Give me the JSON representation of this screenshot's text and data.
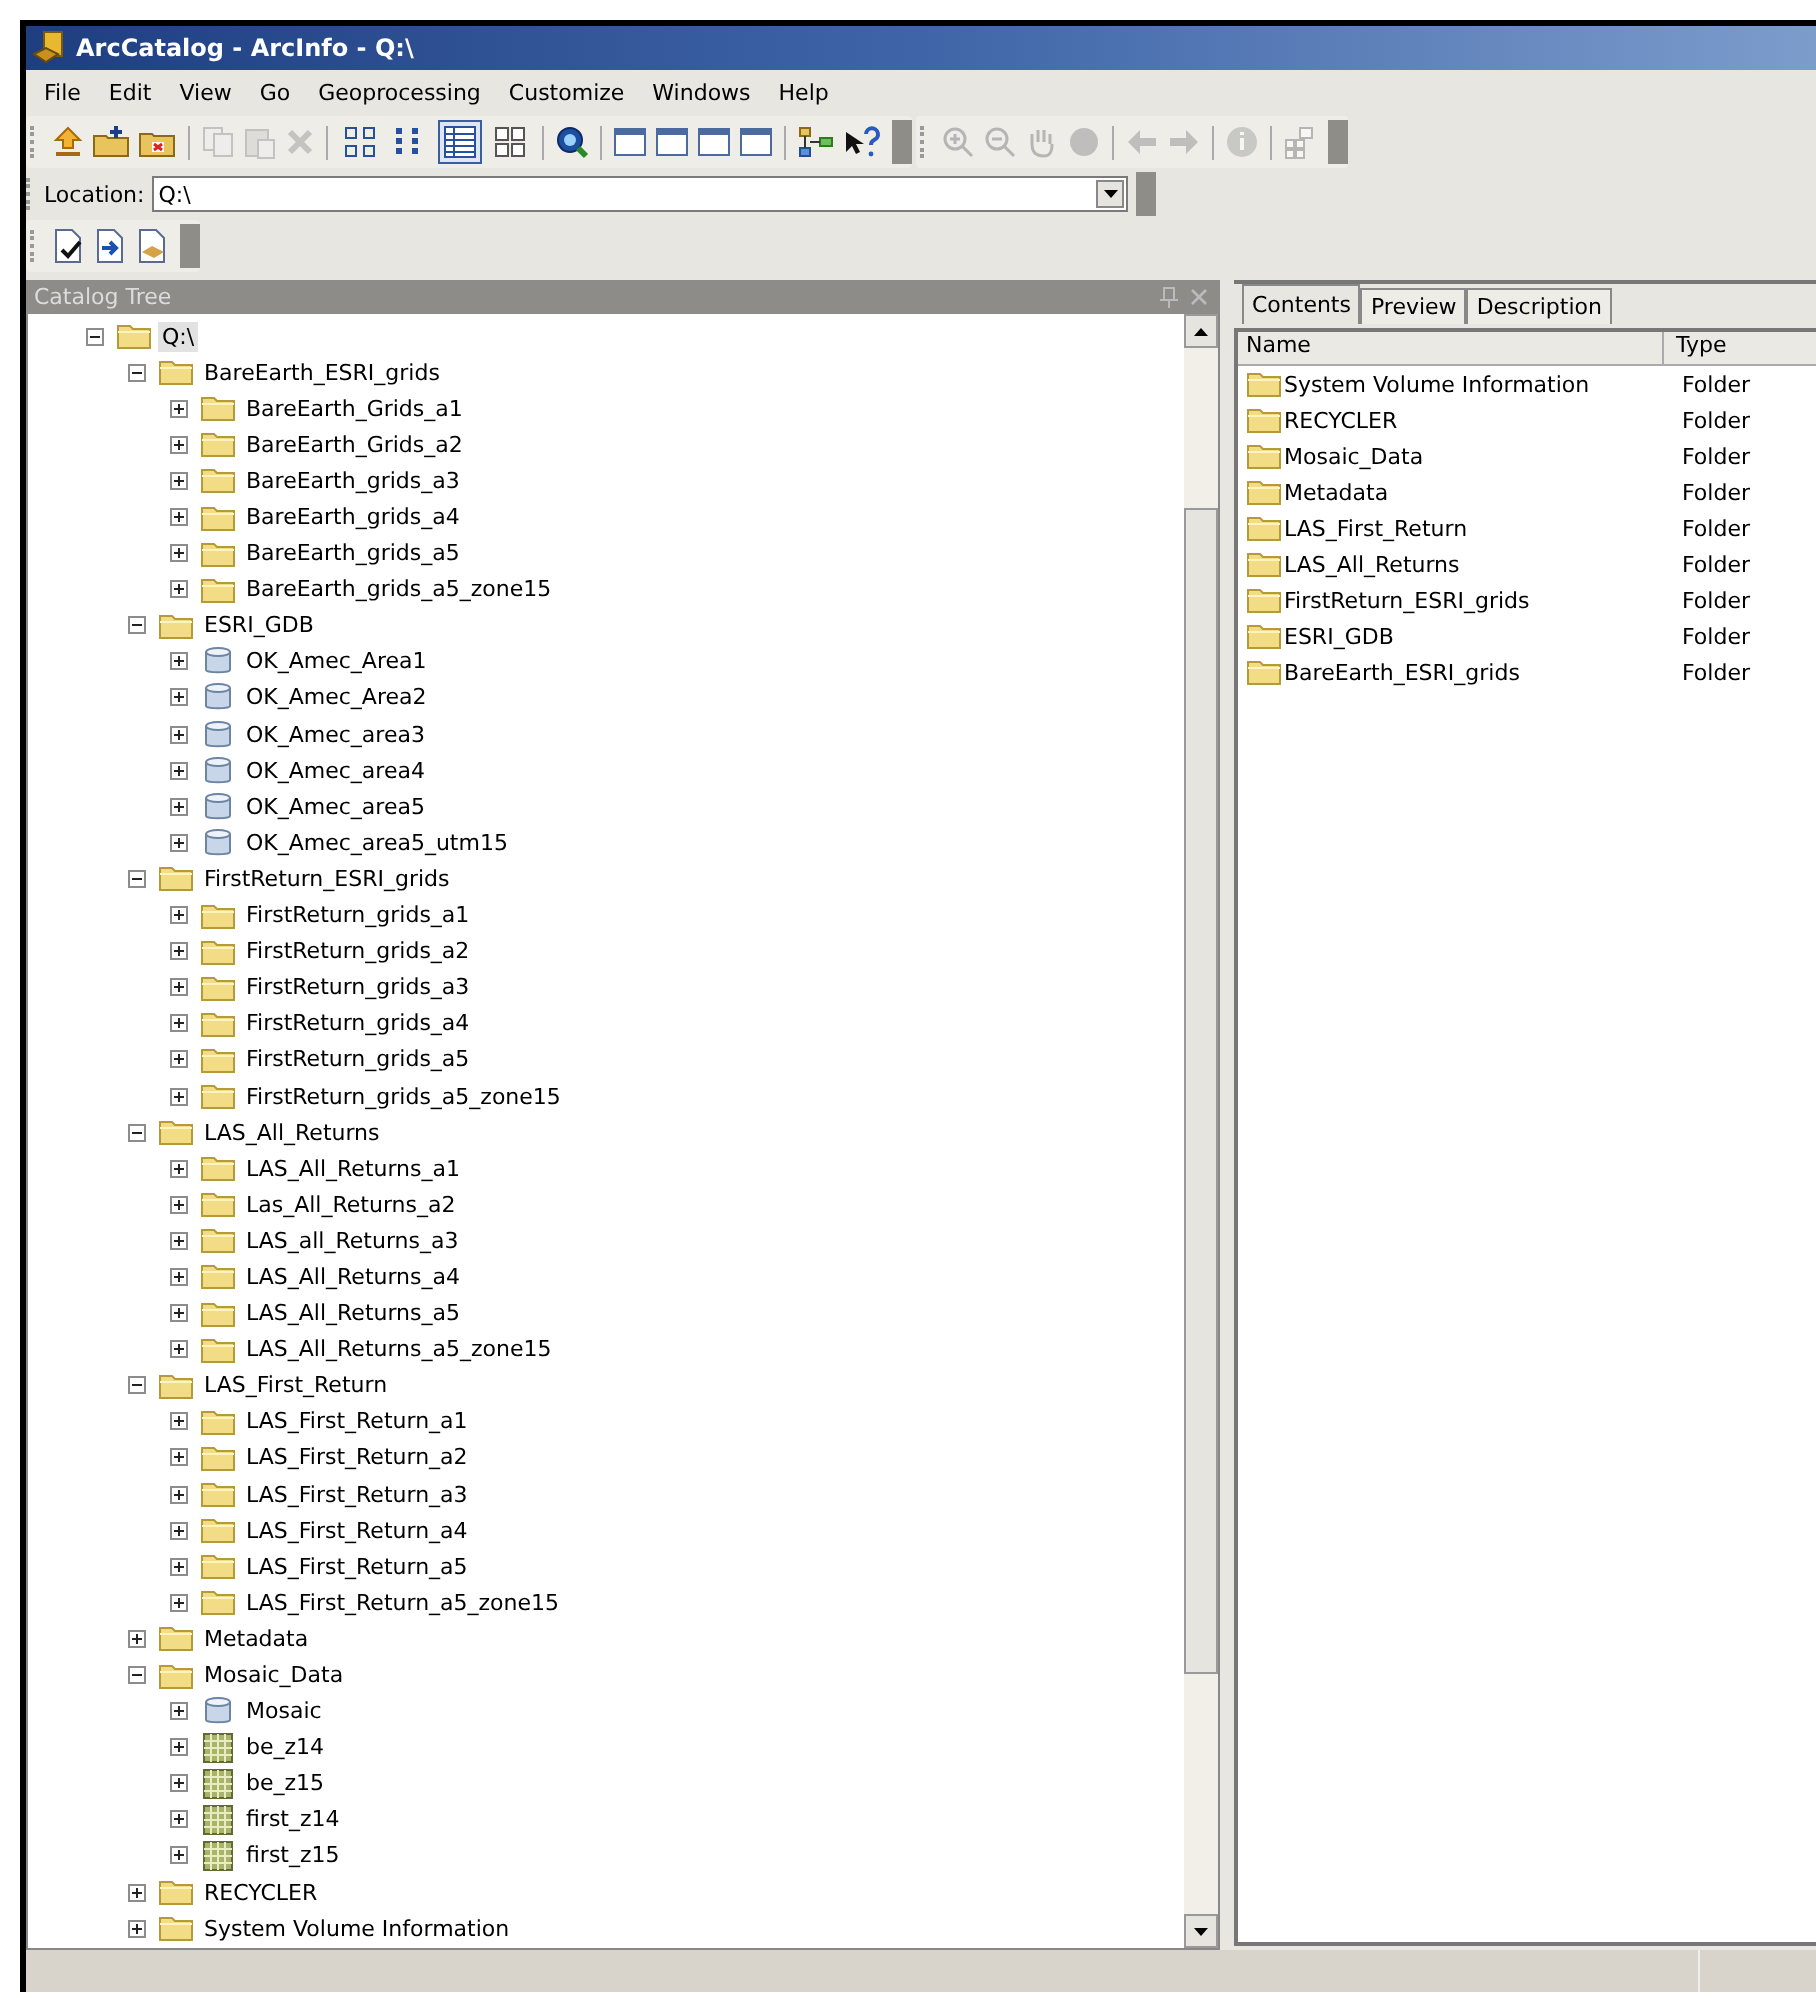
{
  "window": {
    "title": "ArcCatalog - ArcInfo - Q:\\"
  },
  "menu": [
    "File",
    "Edit",
    "View",
    "Go",
    "Geoprocessing",
    "Customize",
    "Windows",
    "Help"
  ],
  "view_buttons": [
    {
      "selected": false
    },
    {
      "selected": false
    },
    {
      "selected": true
    },
    {
      "selected": false
    }
  ],
  "location": {
    "label": "Location:",
    "value": "Q:\\"
  },
  "catalog_tree": {
    "title": "Catalog Tree",
    "tree": [
      {
        "label": "Q:\\",
        "kind": "folder",
        "expanded": true,
        "selected": true,
        "children": [
          {
            "label": "BareEarth_ESRI_grids",
            "kind": "folder",
            "expanded": true,
            "selected": false,
            "children": [
              {
                "label": "BareEarth_Grids_a1",
                "kind": "folder",
                "expanded": false,
                "selected": false
              },
              {
                "label": "BareEarth_Grids_a2",
                "kind": "folder",
                "expanded": false,
                "selected": false
              },
              {
                "label": "BareEarth_grids_a3",
                "kind": "folder",
                "expanded": false,
                "selected": false
              },
              {
                "label": "BareEarth_grids_a4",
                "kind": "folder",
                "expanded": false,
                "selected": false
              },
              {
                "label": "BareEarth_grids_a5",
                "kind": "folder",
                "expanded": false,
                "selected": false
              },
              {
                "label": "BareEarth_grids_a5_zone15",
                "kind": "folder",
                "expanded": false,
                "selected": false
              }
            ]
          },
          {
            "label": "ESRI_GDB",
            "kind": "folder",
            "expanded": true,
            "selected": false,
            "children": [
              {
                "label": "OK_Amec_Area1",
                "kind": "database",
                "expanded": false,
                "selected": false
              },
              {
                "label": "OK_Amec_Area2",
                "kind": "database",
                "expanded": false,
                "selected": false
              },
              {
                "label": "OK_Amec_area3",
                "kind": "database",
                "expanded": false,
                "selected": false
              },
              {
                "label": "OK_Amec_area4",
                "kind": "database",
                "expanded": false,
                "selected": false
              },
              {
                "label": "OK_Amec_area5",
                "kind": "database",
                "expanded": false,
                "selected": false
              },
              {
                "label": "OK_Amec_area5_utm15",
                "kind": "database",
                "expanded": false,
                "selected": false
              }
            ]
          },
          {
            "label": "FirstReturn_ESRI_grids",
            "kind": "folder",
            "expanded": true,
            "selected": false,
            "children": [
              {
                "label": "FirstReturn_grids_a1",
                "kind": "folder",
                "expanded": false,
                "selected": false
              },
              {
                "label": "FirstReturn_grids_a2",
                "kind": "folder",
                "expanded": false,
                "selected": false
              },
              {
                "label": "FirstReturn_grids_a3",
                "kind": "folder",
                "expanded": false,
                "selected": false
              },
              {
                "label": "FirstReturn_grids_a4",
                "kind": "folder",
                "expanded": false,
                "selected": false
              },
              {
                "label": "FirstReturn_grids_a5",
                "kind": "folder",
                "expanded": false,
                "selected": false
              },
              {
                "label": "FirstReturn_grids_a5_zone15",
                "kind": "folder",
                "expanded": false,
                "selected": false
              }
            ]
          },
          {
            "label": "LAS_All_Returns",
            "kind": "folder",
            "expanded": true,
            "selected": false,
            "children": [
              {
                "label": "LAS_All_Returns_a1",
                "kind": "folder",
                "expanded": false,
                "selected": false
              },
              {
                "label": "Las_All_Returns_a2",
                "kind": "folder",
                "expanded": false,
                "selected": false
              },
              {
                "label": "LAS_all_Returns_a3",
                "kind": "folder",
                "expanded": false,
                "selected": false
              },
              {
                "label": "LAS_All_Returns_a4",
                "kind": "folder",
                "expanded": false,
                "selected": false
              },
              {
                "label": "LAS_All_Returns_a5",
                "kind": "folder",
                "expanded": false,
                "selected": false
              },
              {
                "label": "LAS_All_Returns_a5_zone15",
                "kind": "folder",
                "expanded": false,
                "selected": false
              }
            ]
          },
          {
            "label": "LAS_First_Return",
            "kind": "folder",
            "expanded": true,
            "selected": false,
            "children": [
              {
                "label": "LAS_First_Return_a1",
                "kind": "folder",
                "expanded": false,
                "selected": false
              },
              {
                "label": "LAS_First_Return_a2",
                "kind": "folder",
                "expanded": false,
                "selected": false
              },
              {
                "label": "LAS_First_Return_a3",
                "kind": "folder",
                "expanded": false,
                "selected": false
              },
              {
                "label": "LAS_First_Return_a4",
                "kind": "folder",
                "expanded": false,
                "selected": false
              },
              {
                "label": "LAS_First_Return_a5",
                "kind": "folder",
                "expanded": false,
                "selected": false
              },
              {
                "label": "LAS_First_Return_a5_zone15",
                "kind": "folder",
                "expanded": false,
                "selected": false
              }
            ]
          },
          {
            "label": "Metadata",
            "kind": "folder",
            "expanded": false,
            "selected": false
          },
          {
            "label": "Mosaic_Data",
            "kind": "folder",
            "expanded": true,
            "selected": false,
            "children": [
              {
                "label": "Mosaic",
                "kind": "database",
                "expanded": false,
                "selected": false
              },
              {
                "label": "be_z14",
                "kind": "raster",
                "expanded": false,
                "selected": false
              },
              {
                "label": "be_z15",
                "kind": "raster",
                "expanded": false,
                "selected": false
              },
              {
                "label": "first_z14",
                "kind": "raster",
                "expanded": false,
                "selected": false
              },
              {
                "label": "first_z15",
                "kind": "raster",
                "expanded": false,
                "selected": false
              }
            ]
          },
          {
            "label": "RECYCLER",
            "kind": "folder",
            "expanded": false,
            "selected": false
          },
          {
            "label": "System Volume Information",
            "kind": "folder",
            "expanded": false,
            "selected": false
          }
        ]
      }
    ]
  },
  "tabs": [
    {
      "label": "Contents",
      "selected": true
    },
    {
      "label": "Preview",
      "selected": false
    },
    {
      "label": "Description",
      "selected": false
    }
  ],
  "contents": {
    "columns": [
      "Name",
      "Type"
    ],
    "rows": [
      {
        "name": "System Volume Information",
        "type": "Folder",
        "kind": "folder"
      },
      {
        "name": "RECYCLER",
        "type": "Folder",
        "kind": "folder"
      },
      {
        "name": "Mosaic_Data",
        "type": "Folder",
        "kind": "folder"
      },
      {
        "name": "Metadata",
        "type": "Folder",
        "kind": "folder"
      },
      {
        "name": "LAS_First_Return",
        "type": "Folder",
        "kind": "folder"
      },
      {
        "name": "LAS_All_Returns",
        "type": "Folder",
        "kind": "folder"
      },
      {
        "name": "FirstReturn_ESRI_grids",
        "type": "Folder",
        "kind": "folder"
      },
      {
        "name": "ESRI_GDB",
        "type": "Folder",
        "kind": "folder"
      },
      {
        "name": "BareEarth_ESRI_grids",
        "type": "Folder",
        "kind": "folder"
      }
    ]
  }
}
